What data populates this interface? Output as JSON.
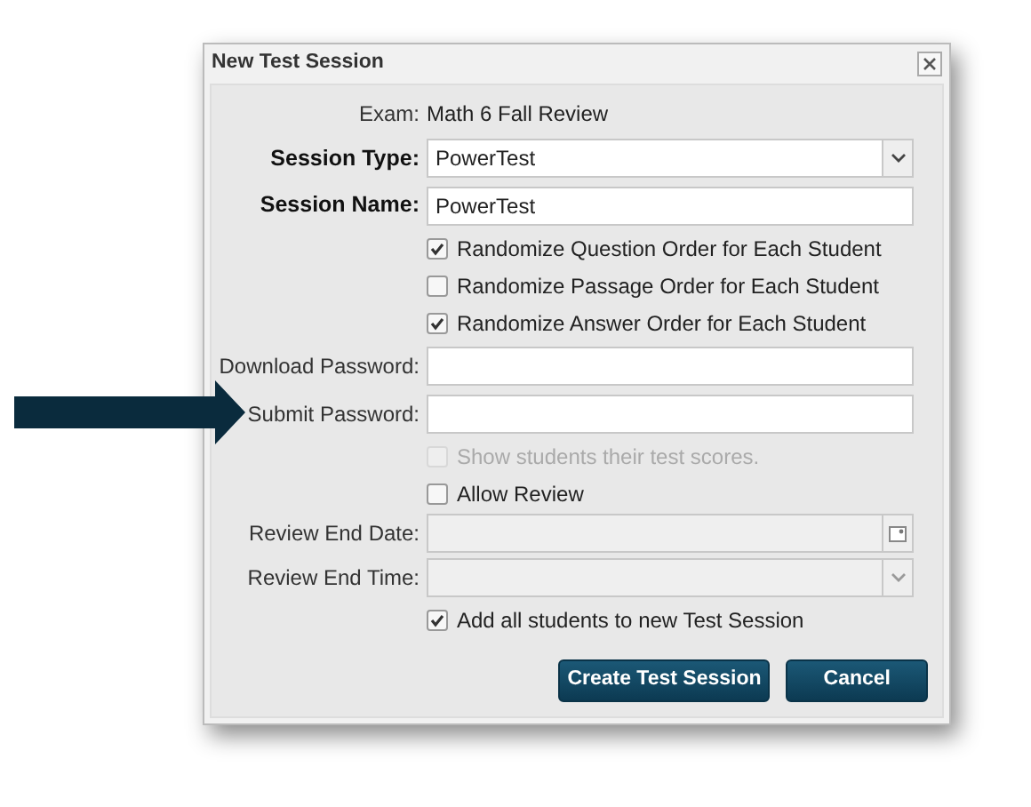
{
  "dialog": {
    "title": "New Test Session",
    "rows": [
      {
        "kind": "info",
        "label": "Exam:",
        "value": "Math 6 Fall Review"
      },
      {
        "kind": "select",
        "label": "Session Type:",
        "bold": true,
        "value": "PowerTest",
        "disabled": false
      },
      {
        "kind": "text",
        "label": "Session Name:",
        "bold": true,
        "value": "PowerTest"
      },
      {
        "kind": "checkbox",
        "label": "Randomize Question Order for Each Student",
        "checked": true,
        "disabled": false
      },
      {
        "kind": "checkbox",
        "label": "Randomize Passage Order for Each Student",
        "checked": false,
        "disabled": false
      },
      {
        "kind": "checkbox",
        "label": "Randomize Answer Order for Each Student",
        "checked": true,
        "disabled": false
      },
      {
        "kind": "text",
        "label": "Download Password:",
        "bold": false
      },
      {
        "kind": "text",
        "label": "Submit Password:",
        "bold": false
      },
      {
        "kind": "checkbox",
        "label": "Show students their test scores.",
        "checked": false,
        "disabled": true
      },
      {
        "kind": "checkbox",
        "label": "Allow Review",
        "checked": false,
        "disabled": false
      },
      {
        "kind": "date",
        "label": "Review End Date:",
        "disabled": true
      },
      {
        "kind": "select",
        "label": "Review End Time:",
        "bold": false,
        "disabled": true
      },
      {
        "kind": "checkbox",
        "label": "Add all students to new Test Session",
        "checked": true,
        "disabled": false
      }
    ],
    "buttons": [
      {
        "label": "Create Test Session"
      },
      {
        "label": "Cancel"
      }
    ]
  }
}
